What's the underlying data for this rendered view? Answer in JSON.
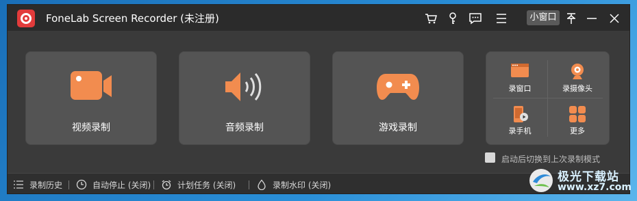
{
  "window": {
    "title": "FoneLab Screen Recorder (未注册)",
    "mini_window_label": "小窗口"
  },
  "titlebar_icons": [
    "cart-icon",
    "key-icon",
    "feedback-icon",
    "menu-icon",
    "pin-icon",
    "minimize-icon",
    "close-icon"
  ],
  "cards": [
    {
      "label": "视频录制",
      "icon": "video-camera-icon"
    },
    {
      "label": "音频录制",
      "icon": "speaker-icon"
    },
    {
      "label": "游戏录制",
      "icon": "gamepad-icon"
    }
  ],
  "mini_panel": [
    {
      "label": "录窗口",
      "icon": "window-record-icon"
    },
    {
      "label": "录摄像头",
      "icon": "webcam-icon"
    },
    {
      "label": "录手机",
      "icon": "phone-record-icon"
    },
    {
      "label": "更多",
      "icon": "grid-more-icon"
    }
  ],
  "restore_option": {
    "label": "启动后切换到上次录制模式",
    "checked": false
  },
  "bottombar": [
    {
      "label": "录制历史",
      "icon": "list-icon"
    },
    {
      "label": "自动停止 (关闭)",
      "icon": "clock-icon"
    },
    {
      "label": "计划任务 (关闭)",
      "icon": "alarm-icon"
    },
    {
      "label": "录制水印 (关闭)",
      "icon": "drop-icon"
    }
  ],
  "watermark": {
    "text": "极光下载站",
    "url": "www.xz7.com"
  },
  "colors": {
    "accent": "#F28C4F",
    "window_bg": "#3A3A3A",
    "card_bg": "#545454",
    "titlebar_bg": "#2B2B2B"
  }
}
